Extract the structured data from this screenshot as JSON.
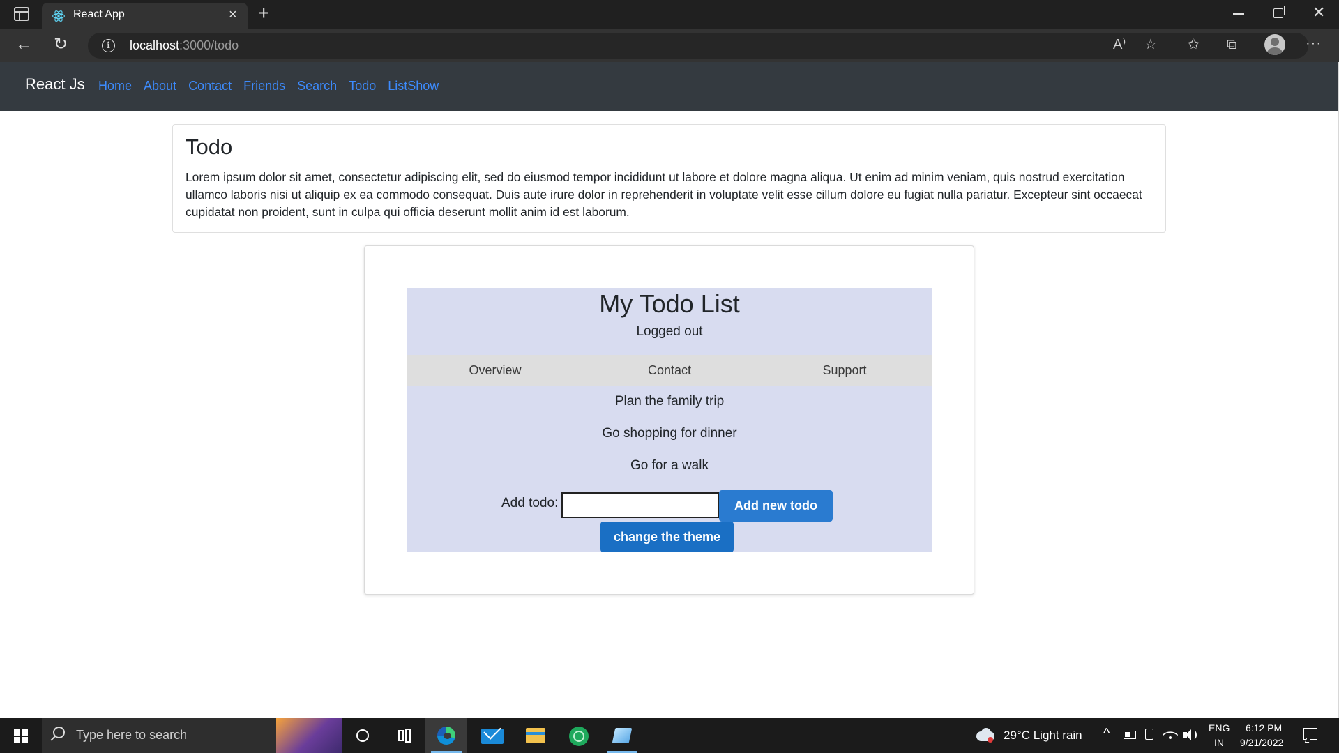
{
  "browser": {
    "tab_title": "React App",
    "tab_close": "×",
    "new_tab": "+",
    "url_host": "localhost",
    "url_path": ":3000/todo",
    "info_glyph": "i",
    "back_glyph": "←",
    "reload_glyph": "↻",
    "read_aloud_glyph": "A⁾",
    "favorite_glyph": "☆",
    "favorites_glyph": "✩",
    "collections_glyph": "⧉",
    "more_glyph": "···",
    "close_window_glyph": "✕"
  },
  "navbar": {
    "brand": "React Js",
    "links": [
      "Home",
      "About",
      "Contact",
      "Friends",
      "Search",
      "Todo",
      "ListShow"
    ]
  },
  "intro_card": {
    "title": "Todo",
    "text": "Lorem ipsum dolor sit amet, consectetur adipiscing elit, sed do eiusmod tempor incididunt ut labore et dolore magna aliqua. Ut enim ad minim veniam, quis nostrud exercitation ullamco laboris nisi ut aliquip ex ea commodo consequat. Duis aute irure dolor in reprehenderit in voluptate velit esse cillum dolore eu fugiat nulla pariatur. Excepteur sint occaecat cupidatat non proident, sunt in culpa qui officia deserunt mollit anim id est laborum."
  },
  "todo": {
    "heading": "My Todo List",
    "status": "Logged out",
    "tabs": [
      "Overview",
      "Contact",
      "Support"
    ],
    "items": [
      "Plan the family trip",
      "Go shopping for dinner",
      "Go for a walk"
    ],
    "add_label": "Add todo:",
    "add_value": "",
    "add_button": "Add new todo",
    "theme_button": "change the theme"
  },
  "taskbar": {
    "search_placeholder": "Type here to search",
    "weather": "29°C  Light rain",
    "lang_line1": "ENG",
    "lang_line2": "IN",
    "time": "6:12 PM",
    "date": "9/21/2022",
    "tray_chevron": "^",
    "notification_glyph": "☐"
  },
  "colors": {
    "navbar_bg": "#343a40",
    "nav_link": "#3d8bfd",
    "todo_panel_bg": "#d8dcf0",
    "tab_row_bg": "#dedede",
    "add_button_bg": "#2a7bd0",
    "theme_button_bg": "#1a6fc4"
  }
}
